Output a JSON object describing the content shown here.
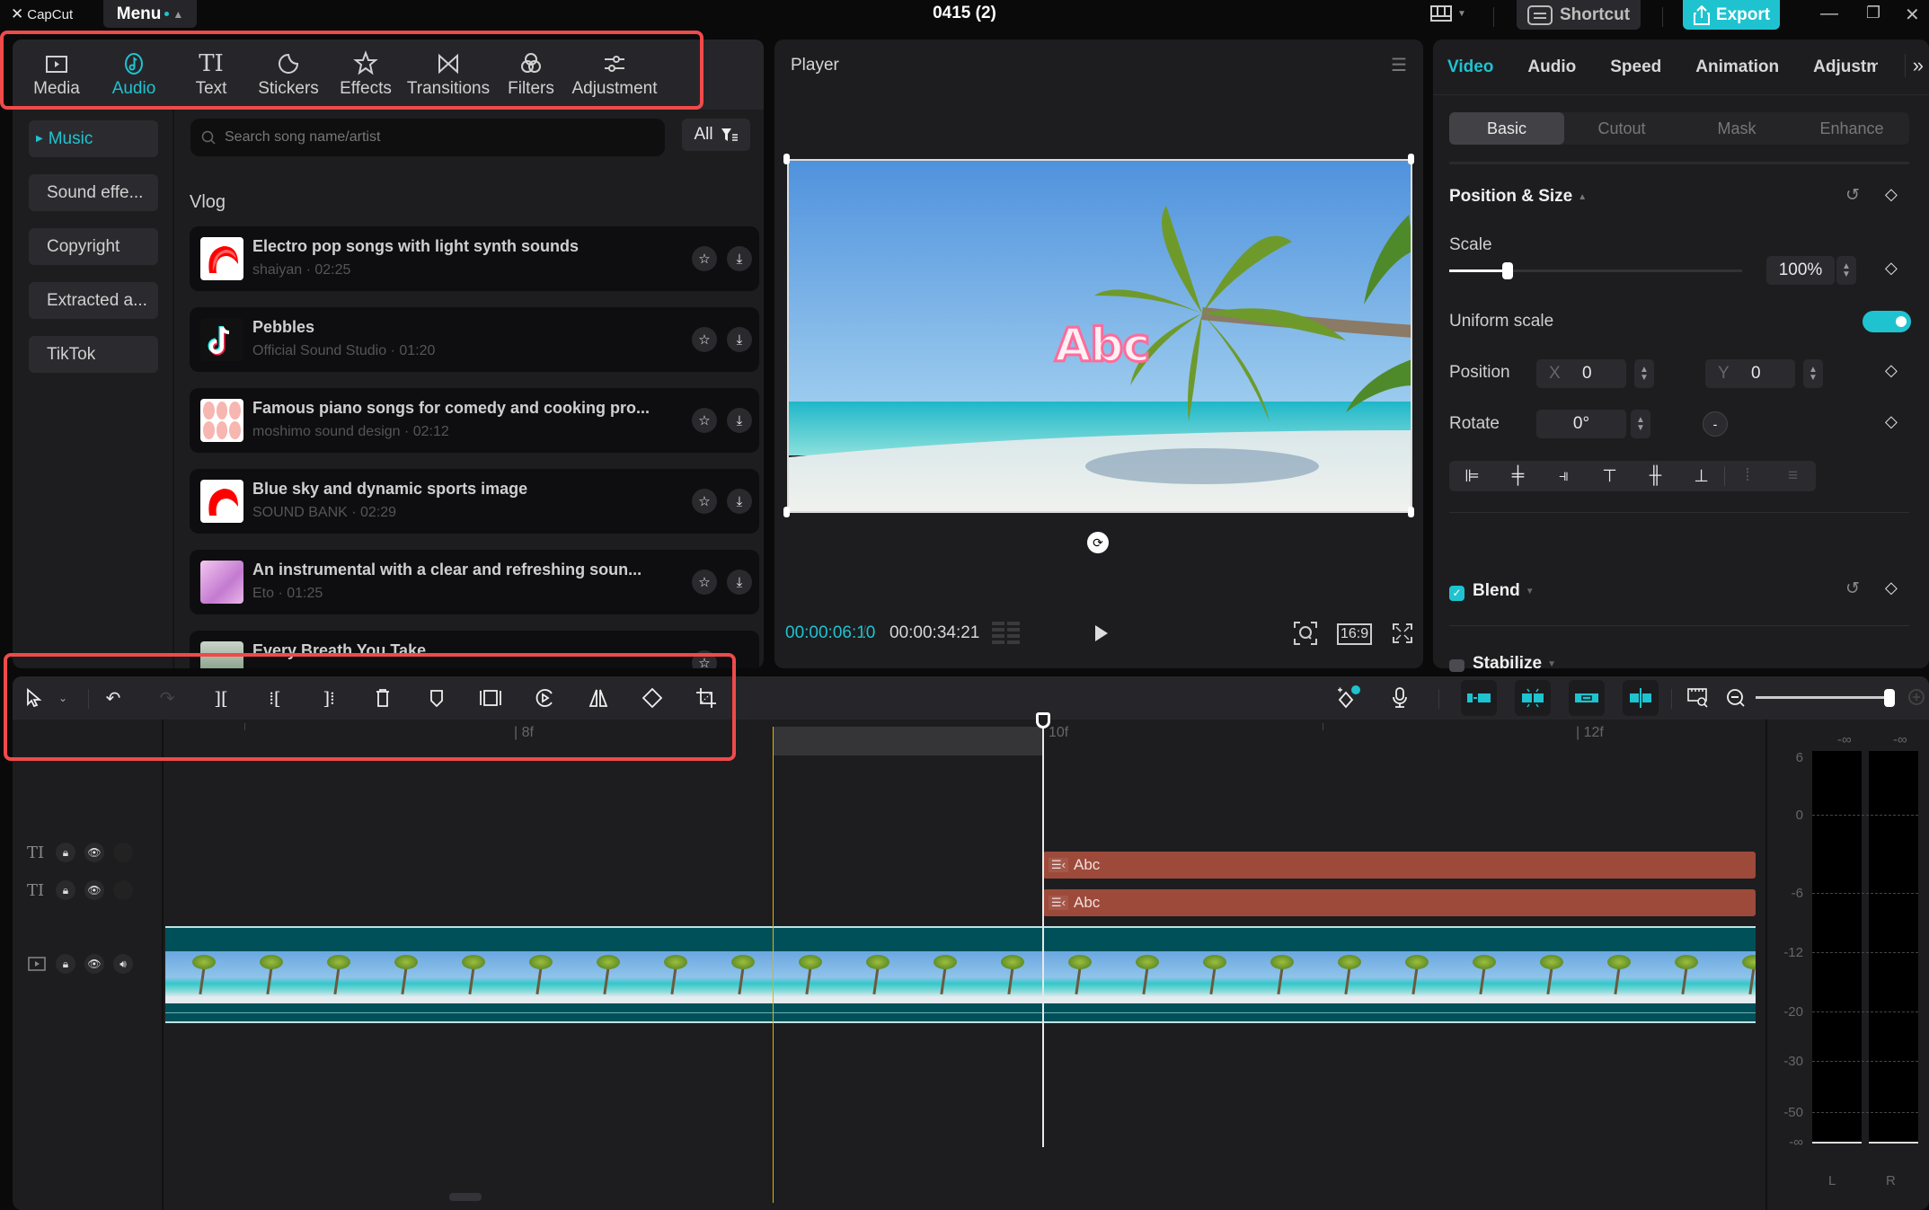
{
  "app": {
    "name": "CapCut",
    "menu_label": "Menu",
    "project_title": "0415 (2)"
  },
  "topbar": {
    "shortcut_label": "Shortcut",
    "export_label": "Export",
    "accent_color": "#1fc3d0"
  },
  "media_tabs": [
    {
      "label": "Media",
      "icon": "media-icon",
      "active": false
    },
    {
      "label": "Audio",
      "icon": "audio-icon",
      "active": true
    },
    {
      "label": "Text",
      "icon": "text-icon",
      "active": false
    },
    {
      "label": "Stickers",
      "icon": "stickers-icon",
      "active": false
    },
    {
      "label": "Effects",
      "icon": "effects-icon",
      "active": false
    },
    {
      "label": "Transitions",
      "icon": "transitions-icon",
      "active": false
    },
    {
      "label": "Filters",
      "icon": "filters-icon",
      "active": false
    },
    {
      "label": "Adjustment",
      "icon": "adjustment-icon",
      "active": false
    }
  ],
  "audio_categories": [
    {
      "label": "Music",
      "active": true
    },
    {
      "label": "Sound effe...",
      "active": false
    },
    {
      "label": "Copyright",
      "active": false
    },
    {
      "label": "Extracted a...",
      "active": false
    },
    {
      "label": "TikTok",
      "active": false
    }
  ],
  "search": {
    "placeholder": "Search song name/artist",
    "filter_label": "All"
  },
  "song_section": "Vlog",
  "songs": [
    {
      "title": "Electro pop songs with light synth sounds",
      "artist": "shaiyan",
      "duration": "02:25",
      "meta": "shaiyan · 02:25"
    },
    {
      "title": "Pebbles",
      "artist": "Official Sound Studio",
      "duration": "01:20",
      "meta": "Official Sound Studio · 01:20"
    },
    {
      "title": "Famous piano songs for comedy and cooking pro...",
      "artist": "moshimo sound design",
      "duration": "02:12",
      "meta": "moshimo sound design · 02:12"
    },
    {
      "title": "Blue sky and dynamic sports image",
      "artist": "SOUND BANK",
      "duration": "02:29",
      "meta": "SOUND BANK · 02:29"
    },
    {
      "title": "An instrumental with a clear and refreshing soun...",
      "artist": "Eto",
      "duration": "01:25",
      "meta": "Eto · 01:25"
    },
    {
      "title": "Every Breath You Take",
      "artist": "",
      "duration": "",
      "meta": ""
    }
  ],
  "player": {
    "title": "Player",
    "overlay_text": "Abc",
    "current_time": "00:00:06:10",
    "separator": "/",
    "total_time": "00:00:34:21",
    "aspect_ratio": "16:9"
  },
  "inspector": {
    "tabs": [
      {
        "label": "Video",
        "active": true
      },
      {
        "label": "Audio",
        "active": false
      },
      {
        "label": "Speed",
        "active": false
      },
      {
        "label": "Animation",
        "active": false
      },
      {
        "label": "Adjustm",
        "active": false
      }
    ],
    "subtabs": [
      {
        "label": "Basic",
        "active": true
      },
      {
        "label": "Cutout",
        "active": false
      },
      {
        "label": "Mask",
        "active": false
      },
      {
        "label": "Enhance",
        "active": false
      }
    ],
    "position_size_title": "Position & Size",
    "scale_label": "Scale",
    "scale_value": "100%",
    "scale_slider_fraction": 0.2,
    "uniform_scale_label": "Uniform scale",
    "uniform_scale_on": true,
    "position_label": "Position",
    "pos_x_label": "X",
    "pos_x": "0",
    "pos_y_label": "Y",
    "pos_y": "0",
    "rotate_label": "Rotate",
    "rotate_value": "0°",
    "blend_label": "Blend",
    "blend_checked": true,
    "stabilize_label": "Stabilize",
    "stabilize_checked": false
  },
  "timeline": {
    "ruler_labels": [
      "8f",
      "10f",
      "12f"
    ],
    "text_clips": [
      {
        "label": "Abc"
      },
      {
        "label": "Abc"
      }
    ],
    "text_clip_color": "#9d4a3b",
    "video_clip_color": "#00505a",
    "zoom_fraction": 1.0
  },
  "audio_meter": {
    "peak_left": "-∞",
    "peak_right": "-∞",
    "scale": [
      "6",
      "0",
      "-6",
      "-12",
      "-20",
      "-30",
      "-50",
      "-∞"
    ],
    "channels": [
      "L",
      "R"
    ]
  }
}
